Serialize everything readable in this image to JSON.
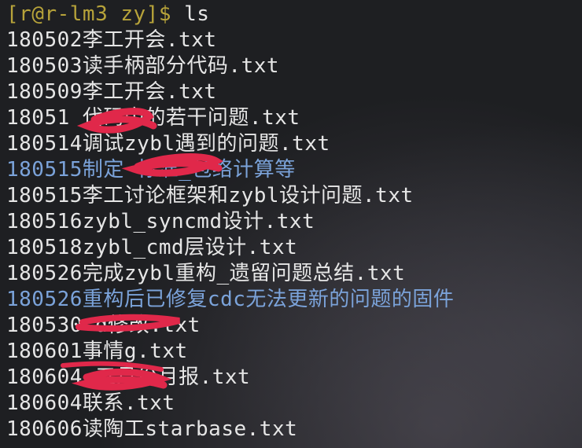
{
  "terminal": {
    "prompt": "[r@r-lm3 zy]$",
    "command": "ls",
    "entries": [
      {
        "name": "180502李工开会.txt",
        "type": "file"
      },
      {
        "name": "180503读手柄部分代码.txt",
        "type": "file"
      },
      {
        "name": "180509李工开会.txt",
        "type": "file"
      },
      {
        "name": "18051 代码中的若干问题.txt",
        "type": "file"
      },
      {
        "name": "180514调试zybl遇到的问题.txt",
        "type": "file"
      },
      {
        "name": "180515制定 标准_包络计算等",
        "type": "directory"
      },
      {
        "name": "180515李工讨论框架和zybl设计问题.txt",
        "type": "file"
      },
      {
        "name": "180516zybl_syncmd设计.txt",
        "type": "file"
      },
      {
        "name": "180518zybl_cmd层设计.txt",
        "type": "file"
      },
      {
        "name": "180526完成zybl重构_遗留问题总结.txt",
        "type": "file"
      },
      {
        "name": "180526重构后已修复cdc无法更新的问题的固件",
        "type": "directory"
      },
      {
        "name": "180530 d修改.txt",
        "type": "file"
      },
      {
        "name": "180601事情g.txt",
        "type": "file"
      },
      {
        "name": "180604 五月份月报.txt",
        "type": "file"
      },
      {
        "name": "180604联系.txt",
        "type": "file"
      },
      {
        "name": "180606读陶工starbase.txt",
        "type": "file"
      }
    ]
  },
  "colors": {
    "background": "#1e1f22",
    "text": "#e6e6e6",
    "prompt": "#b7a33a",
    "directory": "#7ba3da",
    "redaction": "#e0284a"
  }
}
